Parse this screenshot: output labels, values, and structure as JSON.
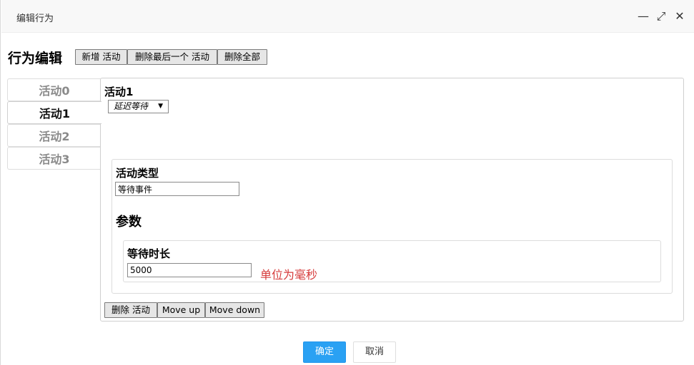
{
  "dialog": {
    "title": "编辑行为",
    "controls": {
      "minimize": "—",
      "maximize": "⤢",
      "close": "✕"
    }
  },
  "toolbar": {
    "heading": "行为编辑",
    "add_label": "新增 活动",
    "delete_last_label": "删除最后一个 活动",
    "delete_all_label": "删除全部"
  },
  "tabs": [
    {
      "label": "活动0",
      "active": false
    },
    {
      "label": "活动1",
      "active": true
    },
    {
      "label": "活动2",
      "active": false
    },
    {
      "label": "活动3",
      "active": false
    }
  ],
  "panel": {
    "title": "活动1",
    "select_value": "延迟等待",
    "activity_type_label": "活动类型",
    "activity_type_value": "等待事件",
    "params_label": "参数",
    "wait_label": "等待时长",
    "wait_value": "5000",
    "wait_hint": "单位为毫秒",
    "delete_label": "删除 活动",
    "move_up_label": "Move up",
    "move_down_label": "Move down"
  },
  "footer": {
    "ok_label": "确定",
    "cancel_label": "取消"
  },
  "colors": {
    "primary": "#2aa1f3",
    "hint": "#d63b3b"
  }
}
